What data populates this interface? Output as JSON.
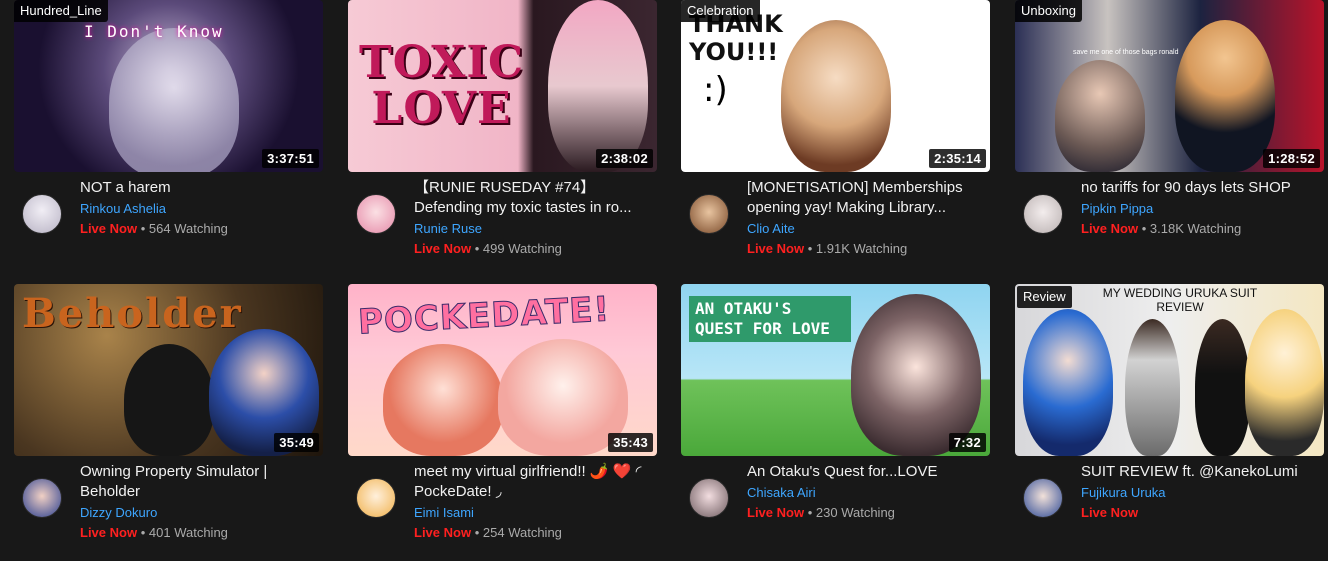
{
  "cards": [
    {
      "tag": "Hundred_Line",
      "thumb_text": "I Don't Know",
      "duration": "3:37:51",
      "title": "NOT a harem",
      "channel": "Rinkou Ashelia",
      "live": "Live Now",
      "watching": "564 Watching"
    },
    {
      "tag": "",
      "thumb_text": "TOXIC LOVE",
      "duration": "2:38:02",
      "title": "【RUNIE RUSEDAY #74】 Defending my toxic tastes in ro...",
      "channel": "Runie Ruse",
      "live": "Live Now",
      "watching": "499 Watching"
    },
    {
      "tag": "Celebration",
      "thumb_text": "THANK YOU!!!",
      "duration": "2:35:14",
      "title": "[MONETISATION] Memberships opening yay! Making Library...",
      "channel": "Clio Aite",
      "live": "Live Now",
      "watching": "1.91K Watching"
    },
    {
      "tag": "Unboxing",
      "thumb_text": "save me one of those bags ronald",
      "duration": "1:28:52",
      "title": "no tariffs for 90 days lets SHOP",
      "channel": "Pipkin Pippa",
      "live": "Live Now",
      "watching": "3.18K Watching"
    },
    {
      "tag": "",
      "thumb_text": "Beholder",
      "duration": "35:49",
      "title": "Owning Property Simulator | Beholder",
      "channel": "Dizzy Dokuro",
      "live": "Live Now",
      "watching": "401 Watching"
    },
    {
      "tag": "",
      "thumb_text": "POCKEDATE!",
      "duration": "35:43",
      "title": "meet my virtual girlfriend!! 🌶️ ❤️ ◜ PockeDate! ◞",
      "channel": "Eimi Isami",
      "live": "Live Now",
      "watching": "254 Watching"
    },
    {
      "tag": "",
      "thumb_text": "AN OTAKU'S QUEST FOR LOVE",
      "duration": "7:32",
      "title": "An Otaku's Quest for...LOVE",
      "channel": "Chisaka Airi",
      "live": "Live Now",
      "watching": "230 Watching"
    },
    {
      "tag": "Review",
      "thumb_text": "MY WEDDING    URUKA SUIT REVIEW",
      "duration": "",
      "title": "SUIT REVIEW ft. @KanekoLumi",
      "channel": "Fujikura Uruka",
      "live": "Live Now",
      "watching": ""
    }
  ],
  "separator": "•",
  "colors": {
    "background": "#181818",
    "channel": "#3ea6ff",
    "live": "#ff2020",
    "duration_bg": "#000000"
  }
}
